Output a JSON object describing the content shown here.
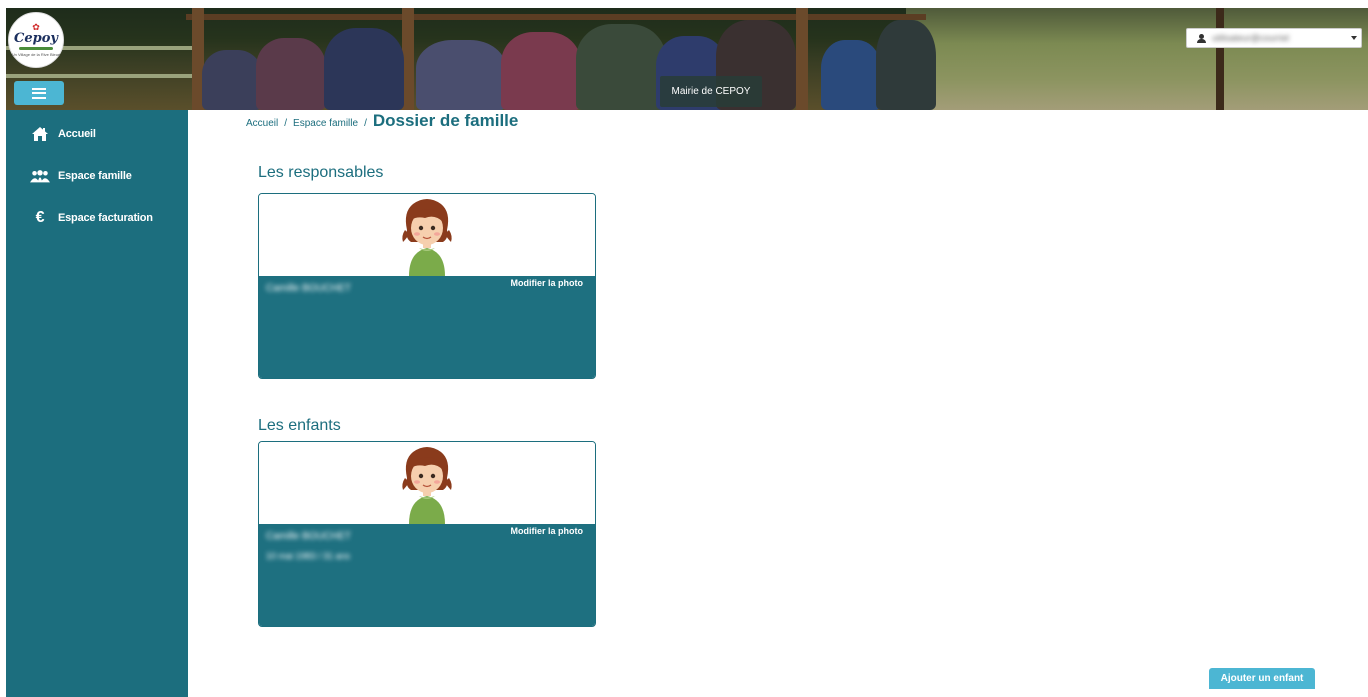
{
  "header": {
    "logo_text": "Cepoy",
    "logo_tagline": "Un Village de la Rive Bleue",
    "banner_label": "Mairie de CEPOY",
    "user_menu_label": "utilisateur@courriel"
  },
  "sidebar": {
    "items": [
      {
        "label": "Accueil",
        "icon": "home-icon"
      },
      {
        "label": "Espace famille",
        "icon": "family-icon"
      },
      {
        "label": "Espace facturation",
        "icon": "euro-icon"
      }
    ]
  },
  "breadcrumb": {
    "items": [
      "Accueil",
      "Espace famille"
    ],
    "separator": "/",
    "current": "Dossier de famille"
  },
  "sections": {
    "responsables": {
      "title": "Les responsables",
      "card": {
        "name": "Camille BOUCHET",
        "modify_label": "Modifier la photo"
      }
    },
    "enfants": {
      "title": "Les enfants",
      "card": {
        "name": "Camille BOUCHET",
        "detail": "10 mai 1983 / 31 ans",
        "modify_label": "Modifier la photo"
      }
    }
  },
  "actions": {
    "add_child_label": "Ajouter un enfant"
  },
  "colors": {
    "primary": "#1c6e7e",
    "accent": "#4cb6d3"
  }
}
